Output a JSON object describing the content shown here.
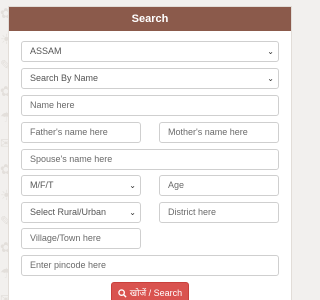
{
  "header": {
    "title": "Search"
  },
  "form": {
    "state": {
      "value": "ASSAM"
    },
    "search_by": {
      "value": "Search By Name"
    },
    "name": {
      "placeholder": "Name here"
    },
    "father_name": {
      "placeholder": "Father's name here"
    },
    "mother_name": {
      "placeholder": "Mother's name here"
    },
    "spouse_name": {
      "placeholder": "Spouse's name here"
    },
    "gender": {
      "value": "M/F/T"
    },
    "age": {
      "placeholder": "Age"
    },
    "area_type": {
      "value": "Select Rural/Urban"
    },
    "district": {
      "placeholder": "District here"
    },
    "village": {
      "placeholder": "Village/Town here"
    },
    "pincode": {
      "placeholder": "Enter pincode here"
    },
    "search_button": {
      "label": "खोजें / Search",
      "icon": "search-icon"
    }
  },
  "colors": {
    "header_bg": "#8b5a4b",
    "button_bg": "#d9534f",
    "page_bg": "#f2f0ee"
  }
}
